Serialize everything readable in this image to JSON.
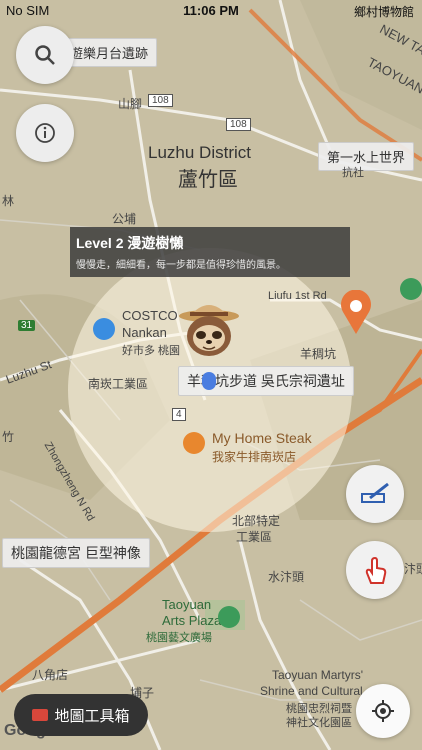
{
  "status_bar": {
    "carrier": "No SIM",
    "time": "11:06 PM",
    "right": "鄉村博物館"
  },
  "map_labels": {
    "top_left_place": "台海山遊樂月台遺跡",
    "new_ta": "NEW TA",
    "taoyuan_top": "TAOYUAN",
    "shanjiao": "山腳",
    "r108": "108",
    "r108b": "108",
    "district_en": "Luzhu District",
    "district_zh": "蘆竹區",
    "poi_right": "第一水上世界",
    "poi_right_sub": "抗社",
    "gongshun": "公埔",
    "lin": "林",
    "liufu_rd": "Liufu 1st Rd",
    "costco_en": "COSTCO",
    "costco_en2": "Nankan",
    "costco_zh": "好市多 桃園",
    "r31": "31",
    "luzhu_st": "Luzhu St",
    "nankan_ind": "南崁工業區",
    "yangchoukeng": "羊稠坑",
    "trail_label": "羊稠坑步道 吳氏宗祠遺址",
    "r4": "4",
    "zhu": "竹",
    "zhongzheng": "Zhongzheng N Rd",
    "steak_en": "My Home Steak",
    "steak_zh": "我家牛排南崁店",
    "bei_bu": "北部特定",
    "bei_bu2": "工業區",
    "temple": "桃園龍德宮 巨型神像",
    "shuimutou": "水汴頭",
    "arts_en": "Taoyuan",
    "arts_en2": "Arts Plaza",
    "arts_zh": "桃園藝文廣場",
    "bajiaodian": "八角店",
    "pu_zi": "埔子",
    "martyrs_en": "Taoyuan Martyrs'",
    "martyrs_en2": "Shrine and Cultural",
    "martyrs_zh": "桃園忠烈祠暨",
    "martyrs_zh2": "神社文化園區",
    "shui_bian_right": "水汴頭",
    "google": "Google"
  },
  "level_card": {
    "title": "Level 2 漫遊樹懶",
    "subtitle": "慢慢走，細細看，每一步都是值得珍惜的風景。"
  },
  "toolbox": {
    "label": "地圖工具箱"
  }
}
